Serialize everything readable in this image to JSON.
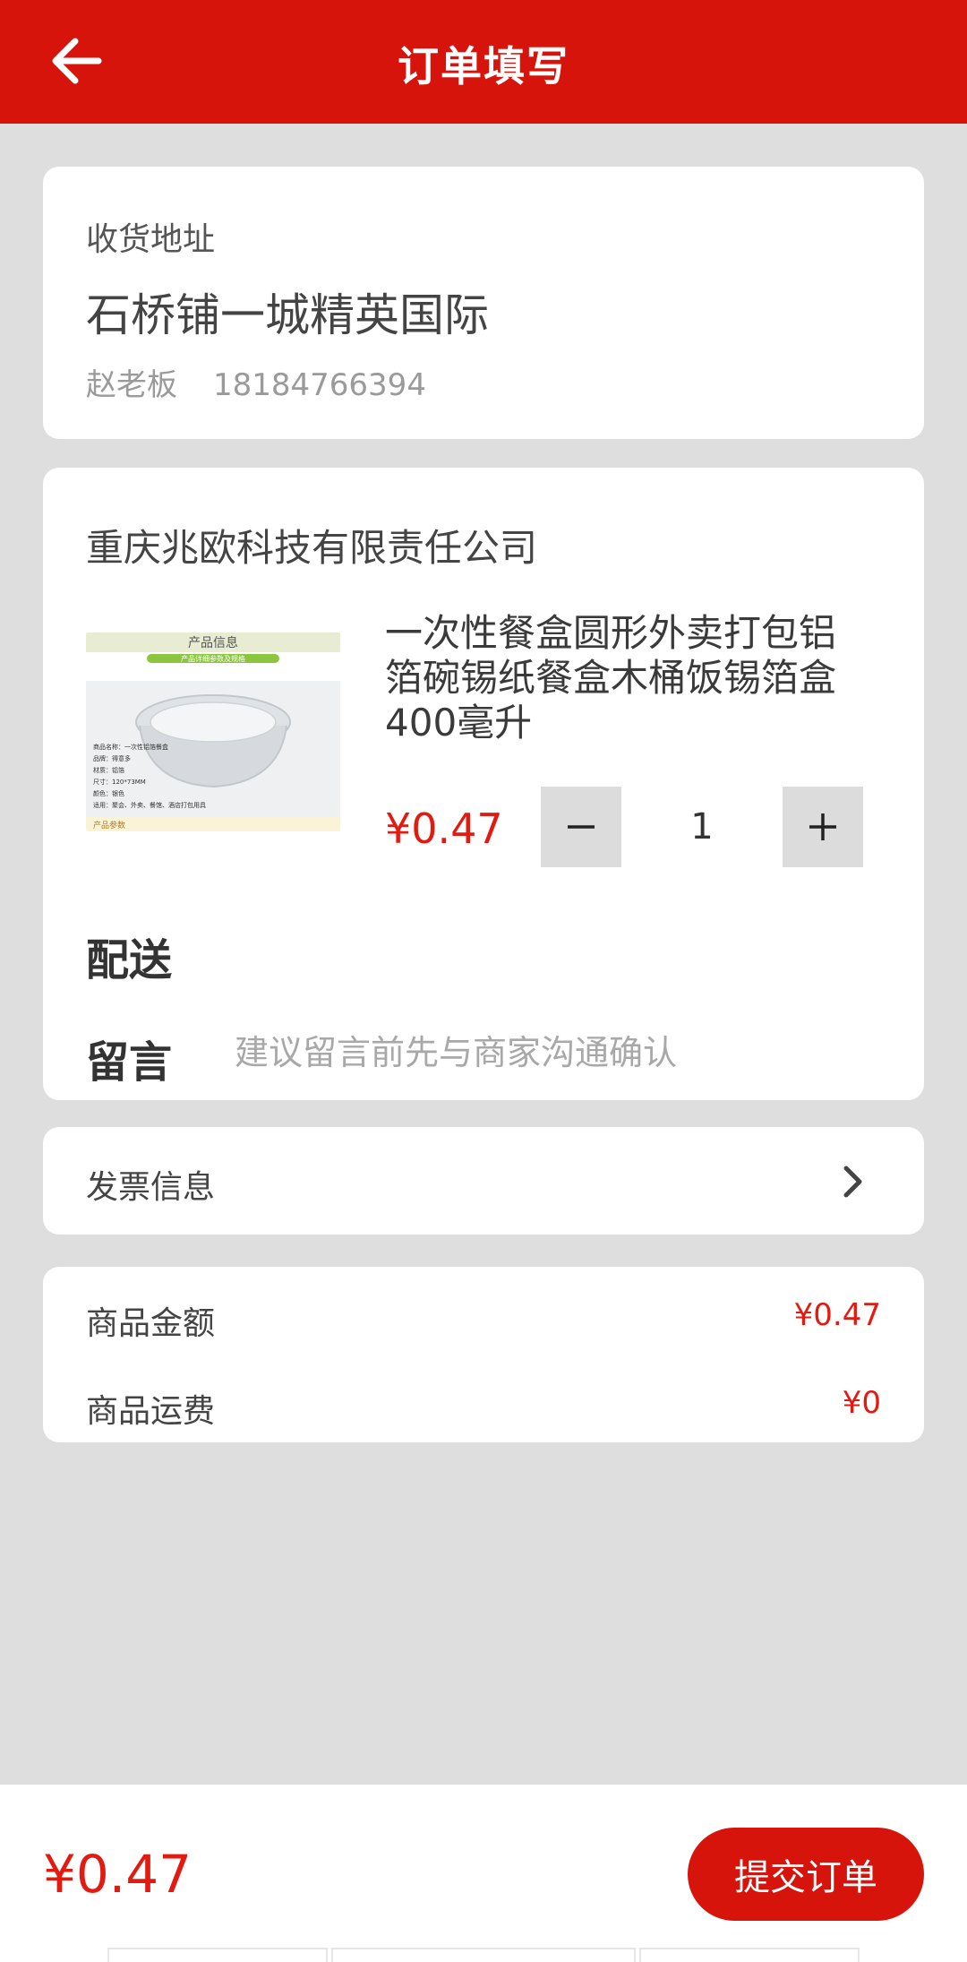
{
  "header": {
    "title": "订单填写"
  },
  "address": {
    "label": "收货地址",
    "location": "石桥铺一城精英国际",
    "name": "赵老板",
    "phone": "18184766394"
  },
  "order": {
    "shop_name": "重庆兆欧科技有限责任公司",
    "product": {
      "title": "一次性餐盒圆形外卖打包铝箔碗锡纸餐盒木桶饭锡箔盒400毫升",
      "price": "¥0.47",
      "quantity": "1",
      "image_text": {
        "heading": "产品信息",
        "subheading": "产品详细参数及规格",
        "specs": [
          "商品名称：一次性铝箔餐盒",
          "品牌：得意多",
          "材质：铝箔",
          "尺寸：120*73MM",
          "颜色：银色",
          "适用：聚会、外卖、餐馆、酒店打包用具"
        ],
        "footer": "产品参数"
      }
    },
    "delivery_label": "配送",
    "message_label": "留言",
    "message_placeholder": "建议留言前先与商家沟通确认"
  },
  "invoice": {
    "label": "发票信息"
  },
  "summary": {
    "goods_amount_label": "商品金额",
    "goods_amount": "¥0.47",
    "shipping_label": "商品运费",
    "shipping": "¥0"
  },
  "footer": {
    "total": "¥0.47",
    "submit_label": "提交订单"
  },
  "colors": {
    "brand_red": "#d7140c",
    "price_red": "#e21b12",
    "background": "#dedede"
  }
}
